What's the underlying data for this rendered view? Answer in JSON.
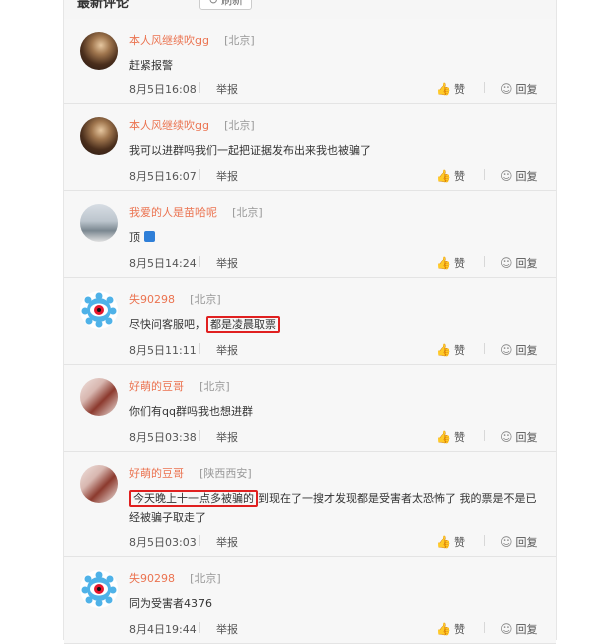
{
  "header": {
    "title": "最新评论",
    "refresh_label": "刷新"
  },
  "actions": {
    "report": "举报",
    "like": "赞",
    "reply": "回复"
  },
  "comments": [
    {
      "user": "本人风继续吹gg",
      "location": "[北京]",
      "text": "赶紧报警",
      "time": "8月5日16:08",
      "avatar": "photo"
    },
    {
      "user": "本人风继续吹gg",
      "location": "[北京]",
      "text": "我可以进群吗我们一起把证据发布出来我也被骗了",
      "time": "8月5日16:07",
      "avatar": "photo"
    },
    {
      "user": "我爱的人是苗哈呢",
      "location": "[北京]",
      "text": "顶",
      "time": "8月5日14:24",
      "avatar": "street"
    },
    {
      "user": "失90298",
      "location": "[北京]",
      "text_before": "尽快问客服吧，",
      "text_highlight": "都是凌晨取票",
      "text_after": "",
      "time": "8月5日11:11",
      "avatar": "logo"
    },
    {
      "user": "好萌的豆哥",
      "location": "[北京]",
      "text": "你们有qq群吗我也想进群",
      "time": "8月5日03:38",
      "avatar": "dog"
    },
    {
      "user": "好萌的豆哥",
      "location": "[陕西西安]",
      "text_before": "",
      "text_highlight": "今天晚上十一点多被骗的",
      "text_after": "到现在了一搜才发现都是受害者太恐怖了 我的票是不是已经被骗子取走了",
      "time": "8月5日03:03",
      "avatar": "dog"
    },
    {
      "user": "失90298",
      "location": "[北京]",
      "text": "同为受害者4376",
      "time": "8月4日19:44",
      "avatar": "logo"
    }
  ]
}
